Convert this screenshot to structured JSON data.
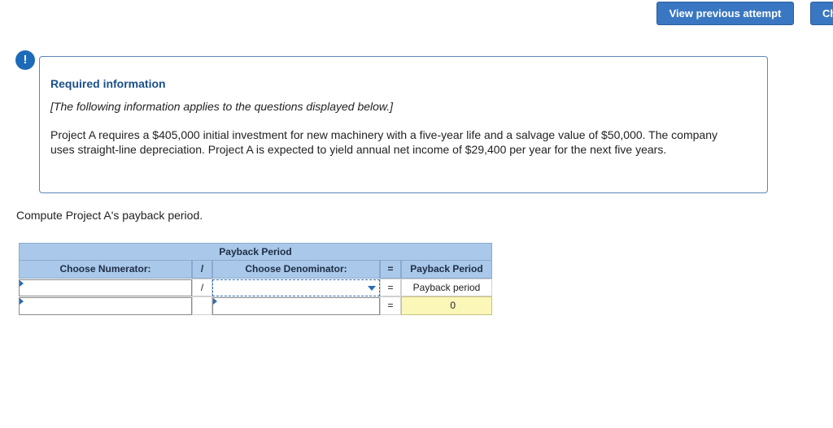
{
  "header": {
    "view_previous_label": "View previous attempt",
    "check_label": "Ch"
  },
  "alert": {
    "icon_glyph": "!",
    "title": "Required information",
    "note": "[The following information applies to the questions displayed below.]",
    "body": "Project A requires a $405,000 initial investment for new machinery with a five-year life and a salvage value of $50,000. The company uses straight-line depreciation. Project A is expected to yield annual net income of $29,400 per year for the next five years."
  },
  "question": "Compute Project A's payback period.",
  "table": {
    "title": "Payback Period",
    "headers": {
      "numerator": "Choose Numerator:",
      "divide": "/",
      "denominator": "Choose Denominator:",
      "equals": "=",
      "result": "Payback Period"
    },
    "rows": [
      {
        "numerator": "",
        "divide": "/",
        "denominator": "",
        "equals": "=",
        "result": "Payback period"
      },
      {
        "numerator": "",
        "divide": "",
        "denominator": "",
        "equals": "=",
        "result": "0"
      }
    ]
  },
  "colors": {
    "accent": "#3a77c2",
    "header_bg": "#a9c8ea",
    "result_bg": "#fbf7b8"
  }
}
